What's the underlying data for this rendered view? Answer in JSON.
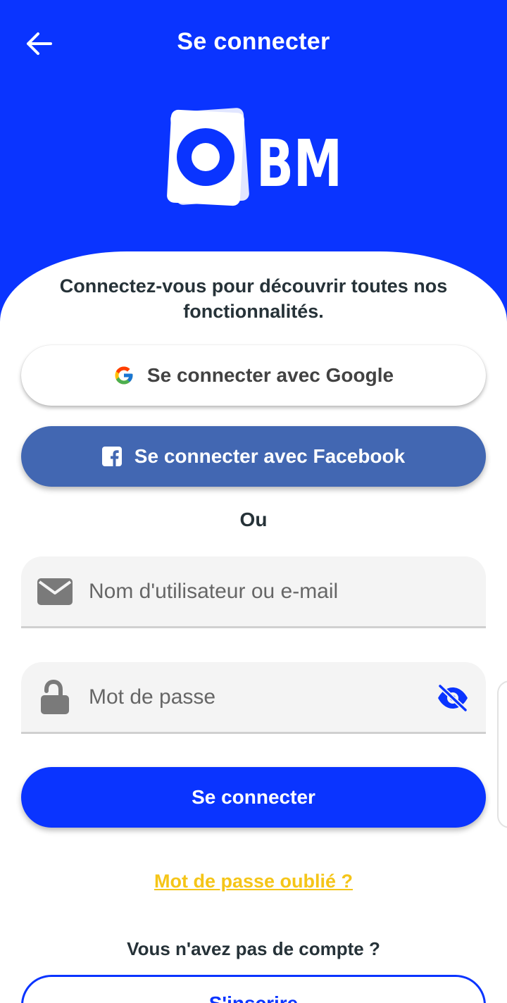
{
  "header": {
    "title": "Se connecter",
    "back_icon": "arrow-left-icon"
  },
  "logo": {
    "text": "BM",
    "icon": "obm-logo"
  },
  "intro": {
    "text": "Connectez-vous pour découvrir toutes nos fonctionnalités."
  },
  "social": {
    "google_label": "Se connecter avec Google",
    "google_icon": "google-icon",
    "facebook_label": "Se connecter avec Facebook",
    "facebook_icon": "facebook-icon"
  },
  "divider": {
    "text": "Ou"
  },
  "form": {
    "username_placeholder": "Nom d'utilisateur ou e-mail",
    "username_value": "",
    "username_icon": "envelope-icon",
    "password_placeholder": "Mot de passe",
    "password_value": "",
    "password_icon": "unlock-icon",
    "visibility_icon": "eye-slash-icon",
    "login_label": "Se connecter"
  },
  "links": {
    "forgot_password": "Mot de passe oublié ?",
    "no_account": "Vous n'avez pas de compte ?",
    "register_label": "S'inscrire"
  },
  "colors": {
    "primary": "#0a34ff",
    "facebook": "#4267b2",
    "link": "#f5c518",
    "text": "#263238"
  }
}
